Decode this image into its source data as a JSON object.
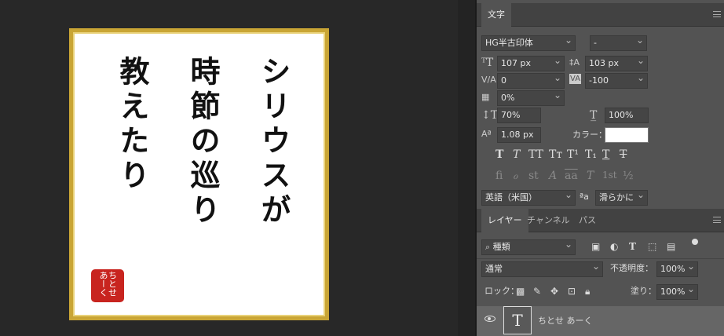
{
  "canvas": {
    "calligraphy": {
      "col1": "シリウスが",
      "col2": "時節の巡り",
      "col3": "教えたり"
    },
    "seal_text": "ちとせ あーく"
  },
  "character_panel": {
    "tab_label": "文字",
    "font_family": "HG半古印体",
    "font_style": "-",
    "font_size": "107 px",
    "leading": "103 px",
    "kerning": "0",
    "tracking": "-100",
    "tsume": "0%",
    "vertical_scale": "70%",
    "horizontal_scale": "100%",
    "baseline_shift": "1.08 px",
    "color_label": "カラー：",
    "text_color": "#ffffff",
    "language": "英語（米国）",
    "aa_label": "ªa",
    "antialias": "滑らかに",
    "style_buttons": [
      "T",
      "T",
      "TT",
      "Tт",
      "T¹",
      "T₁",
      "T",
      "T"
    ],
    "opentype_buttons": [
      "ﬁ",
      "ℴ",
      "st",
      "A",
      "aa",
      "T",
      "1st",
      "½"
    ]
  },
  "layers_panel": {
    "tabs": [
      "レイヤー",
      "チャンネル",
      "パス"
    ],
    "filter_kind": "種類",
    "blend_mode": "通常",
    "opacity_label": "不透明度：",
    "opacity": "100%",
    "lock_label": "ロック：",
    "fill_label": "塗り：",
    "fill": "100%",
    "layer_name": "ちとせ あーく",
    "layer_thumb": "T"
  },
  "colors": {
    "panel_bg": "#535353",
    "frame_gold": "#c9a535",
    "seal_red": "#c8241f"
  }
}
